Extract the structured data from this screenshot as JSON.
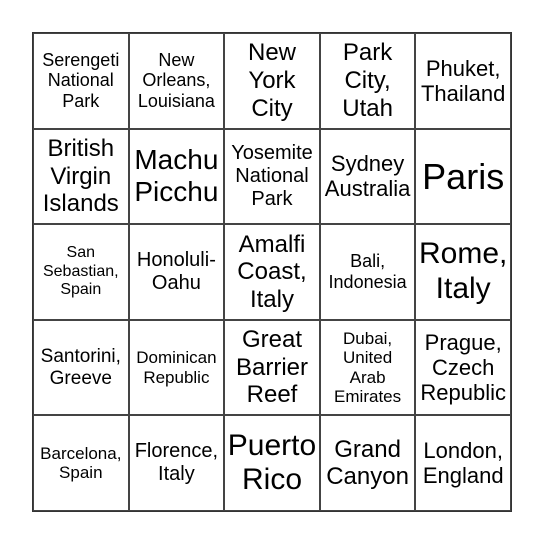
{
  "cells": [
    "Serengeti\nNational\nPark",
    "New\nOrleans,\nLouisiana",
    "New\nYork\nCity",
    "Park\nCity,\nUtah",
    "Phuket,\nThailand",
    "British\nVirgin\nIslands",
    "Machu\nPicchu",
    "Yosemite\nNational\nPark",
    "Sydney\nAustralia",
    "Paris",
    "San\nSebastian,\nSpain",
    "Honoluli-\nOahu",
    "Amalfi\nCoast,\nItaly",
    "Bali,\nIndonesia",
    "Rome,\nItaly",
    "Santorini,\nGreeve",
    "Dominican\nRepublic",
    "Great\nBarrier\nReef",
    "Dubai,\nUnited\nArab\nEmirates",
    "Prague,\nCzech\nRepublic",
    "Barcelona,\nSpain",
    "Florence,\nItaly",
    "Puerto\nRico",
    "Grand\nCanyon",
    "London,\nEngland"
  ]
}
